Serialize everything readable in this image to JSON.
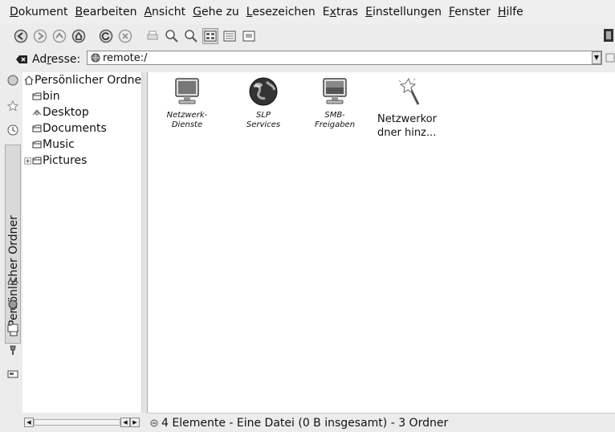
{
  "menubar": {
    "items": [
      {
        "u": "D",
        "rest": "okument"
      },
      {
        "u": "B",
        "rest": "earbeiten"
      },
      {
        "u": "A",
        "rest": "nsicht"
      },
      {
        "u": "G",
        "rest": "ehe zu"
      },
      {
        "u": "L",
        "rest": "esezeichen"
      },
      {
        "pre": "E",
        "u": "x",
        "rest": "tras"
      },
      {
        "u": "E",
        "rest": "instellungen"
      },
      {
        "u": "F",
        "rest": "enster"
      },
      {
        "u": "H",
        "rest": "ilfe"
      }
    ]
  },
  "location": {
    "label_pre": "Ad",
    "label_u": "r",
    "label_post": "esse:",
    "value": "remote:/"
  },
  "sidebar": {
    "active_tab_label": "Persönlicher Ordner"
  },
  "tree": {
    "root": "Persönlicher Ordne",
    "items": [
      "bin",
      "Desktop",
      "Documents",
      "Music",
      "Pictures"
    ]
  },
  "main": {
    "items": [
      {
        "label": "Netzwerk-\nDienste",
        "icon": "monitor-icon"
      },
      {
        "label": "SLP\nServices",
        "icon": "globe-icon"
      },
      {
        "label": "SMB-\nFreigaben",
        "icon": "monitor-share-icon"
      },
      {
        "label": "Netzwerkor\ndner hinz...",
        "icon": "magic-wand-icon"
      }
    ]
  },
  "status": {
    "text": "4 Elemente - Eine Datei (0 B insgesamt) - 3 Ordner"
  }
}
